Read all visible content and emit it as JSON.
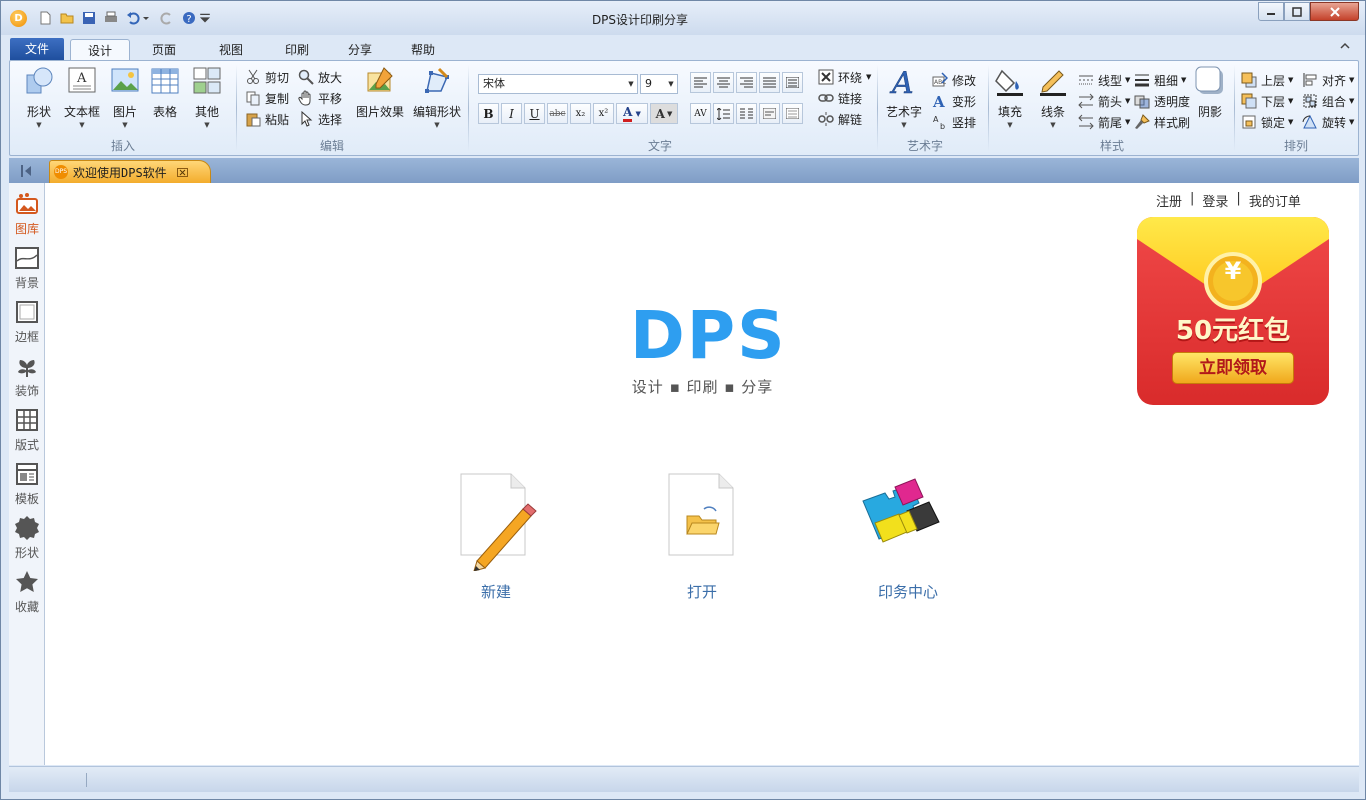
{
  "window": {
    "title": "DPS设计印刷分享"
  },
  "menu": {
    "file": "文件",
    "tabs": [
      "设计",
      "页面",
      "视图",
      "印刷",
      "分享",
      "帮助"
    ]
  },
  "ribbon": {
    "insert": {
      "label": "插入",
      "buttons": [
        "形状",
        "文本框",
        "图片",
        "表格",
        "其他"
      ]
    },
    "edit": {
      "label": "编辑",
      "cut": "剪切",
      "copy": "复制",
      "paste": "粘贴",
      "zoom": "放大",
      "pan": "平移",
      "select": "选择",
      "pic_effect": "图片效果",
      "edit_shape": "编辑形状"
    },
    "text": {
      "label": "文字",
      "font": "宋体",
      "size": "9",
      "wrap": "环绕",
      "link": "链接",
      "unlink": "解链"
    },
    "art": {
      "label": "艺术字",
      "button": "艺术字",
      "modify": "修改",
      "transform": "变形",
      "vertical": "竖排"
    },
    "style": {
      "label": "样式",
      "fill": "填充",
      "line": "线条",
      "line_type": "线型",
      "arrow": "箭头",
      "tail": "箭尾",
      "thickness": "粗细",
      "transparency": "透明度",
      "format_brush": "样式刷",
      "shadow": "阴影"
    },
    "arrange": {
      "label": "排列",
      "up": "上层",
      "down": "下层",
      "lock": "锁定",
      "align": "对齐",
      "group": "组合",
      "rotate": "旋转"
    }
  },
  "doc_tab": {
    "title": "欢迎使用DPS软件"
  },
  "sidebar": {
    "items": [
      "图库",
      "背景",
      "边框",
      "装饰",
      "版式",
      "模板",
      "形状",
      "收藏"
    ]
  },
  "canvas": {
    "links": {
      "register": "注册",
      "login": "登录",
      "orders": "我的订单",
      "sep": "|"
    },
    "logo": "DPS",
    "slogan": "设计 ▪ 印刷 ▪ 分享",
    "actions": {
      "new": "新建",
      "open": "打开",
      "print_center": "印务中心"
    },
    "promo": {
      "amount": "50元红包",
      "button": "立即领取",
      "coin": "¥"
    }
  },
  "colors": {
    "accent": "#2e9ef0",
    "promo_red": "#e83b3b",
    "promo_yellow": "#ffd63a",
    "link": "#3b6ea9"
  }
}
